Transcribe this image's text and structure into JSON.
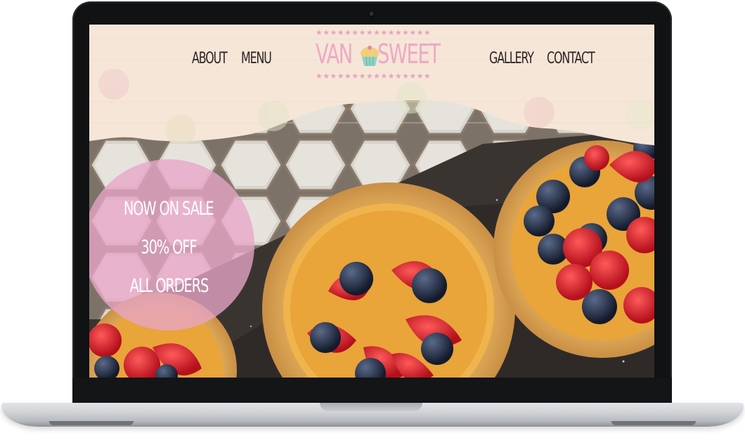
{
  "nav": {
    "about": "ABOUT",
    "menu": "MENU",
    "gallery": "GALLERY",
    "contact": "CONTACT"
  },
  "logo": {
    "left_word": "VAN",
    "right_word": "SWEET",
    "icon": "cupcake-icon"
  },
  "promo": {
    "line1": "NOW ON SALE",
    "line2": "30% OFF",
    "line3": "ALL ORDERS"
  },
  "colors": {
    "header_bg": "#f6e6d8",
    "logo_pink": "#eea9c4",
    "promo_pink": "#e8a5c6",
    "nav_text": "#2b2423"
  }
}
